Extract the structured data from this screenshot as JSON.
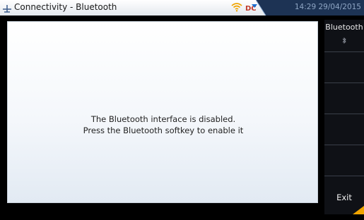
{
  "window": {
    "title": "Connectivity - Bluetooth",
    "time": "14:29",
    "date": "29/04/2015"
  },
  "status_icons": [
    "antenna-icon",
    "wifi-icon",
    "dc-power-icon"
  ],
  "message": {
    "line1": "The Bluetooth interface is disabled.",
    "line2": "Press the Bluetooth softkey to enable it"
  },
  "softkeys": {
    "bluetooth_label": "Bluetooth",
    "exit_label": "Exit"
  },
  "colors": {
    "accent": "#f0a400",
    "softkey_bg": "#0f1116",
    "clock_text": "#8fa6c4"
  }
}
